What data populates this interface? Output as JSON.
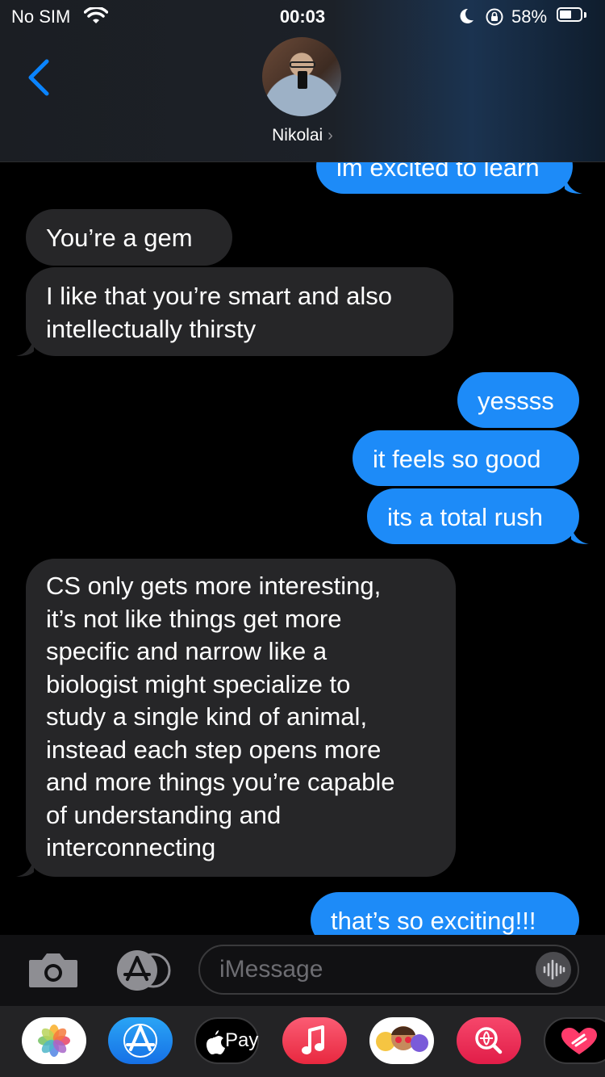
{
  "status": {
    "carrier": "No SIM",
    "time": "00:03",
    "battery": "58%",
    "battery_level": 0.58
  },
  "header": {
    "contact": "Nikolai"
  },
  "messages": [
    {
      "dir": "out",
      "text": "im excited to learn"
    },
    {
      "dir": "in",
      "text": "You’re a gem"
    },
    {
      "dir": "in",
      "lines": [
        "I like that you’re smart and also",
        "intellectually thirsty"
      ]
    },
    {
      "dir": "out",
      "text": "yessss"
    },
    {
      "dir": "out",
      "text": "it feels so good"
    },
    {
      "dir": "out",
      "text": "its a total rush"
    },
    {
      "dir": "in",
      "lines": [
        "CS only gets more interesting,",
        "it’s not like things get more",
        "specific and narrow like a",
        "biologist might specialize to",
        "study a single kind of animal,",
        "instead each step opens more",
        "and more things you’re capable",
        "of understanding and",
        "interconnecting"
      ]
    },
    {
      "dir": "out",
      "text": "that’s so exciting!!!"
    }
  ],
  "input": {
    "placeholder": "iMessage"
  },
  "apps": {
    "photos": "photos-icon",
    "store": "app-store-icon",
    "pay": "Pay",
    "music": "music-icon",
    "memoji": "memoji-icon",
    "search": "image-search-icon",
    "digital_touch": "digital-touch-icon"
  },
  "colors": {
    "outgoing": "#1d8bf8",
    "incoming": "#262628",
    "accent": "#0a84ff"
  }
}
